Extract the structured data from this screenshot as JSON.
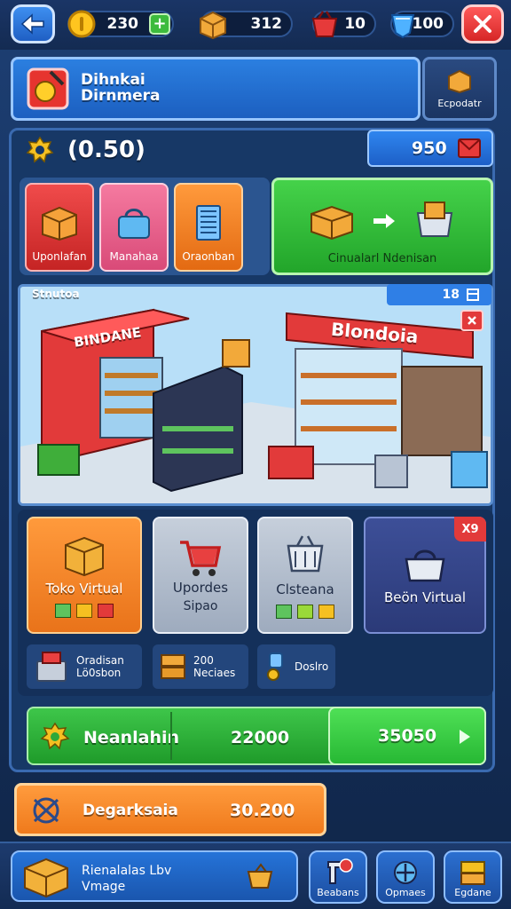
{
  "topbar": {
    "coins": "230",
    "boxes": "312",
    "baskets": "10",
    "gems": "100"
  },
  "header": {
    "title_line1": "Dihnkai",
    "title_line2": "Dirnmera",
    "side_label": "Ecpodatr"
  },
  "stats": {
    "value": "(0.50)",
    "box_value": "950"
  },
  "categories": [
    {
      "label": "Uponlafan"
    },
    {
      "label": "Manahaa"
    },
    {
      "label": "Oraonban"
    }
  ],
  "convert": {
    "label": "Cinualarl Ndenisan"
  },
  "scene": {
    "label": "Stnutoa",
    "badge": "18",
    "sign_left": "BINDANE",
    "sign_right": "Blondoia"
  },
  "cards": [
    {
      "label": "Toko Virtual"
    },
    {
      "label": "Upordes",
      "sublabel": "Sipao"
    },
    {
      "label": "Clsteana"
    },
    {
      "label": "Beön Virtual",
      "badge": "X9"
    }
  ],
  "mini": [
    {
      "line1": "Oradisan",
      "line2": "Lö0sbon"
    },
    {
      "line1": "200",
      "line2": "Neciaes"
    },
    {
      "line1": "Doslro",
      "line2": ""
    }
  ],
  "green_bar": {
    "label": "Neanlahin",
    "value1": "22000",
    "value2": "35050"
  },
  "orange_bar": {
    "label": "Degarksaia",
    "value": "30.200"
  },
  "bottom": {
    "wide_line1": "Rienalalas Lbv",
    "wide_line2": "Vmage",
    "btn1": "Beabans",
    "btn2": "Opmaes",
    "btn3": "Egdane"
  },
  "colors": {
    "background": "#15305c",
    "accent_blue": "#2b7fe0",
    "green": "#2fb83a",
    "orange": "#f08a2a",
    "red": "#e03030"
  }
}
